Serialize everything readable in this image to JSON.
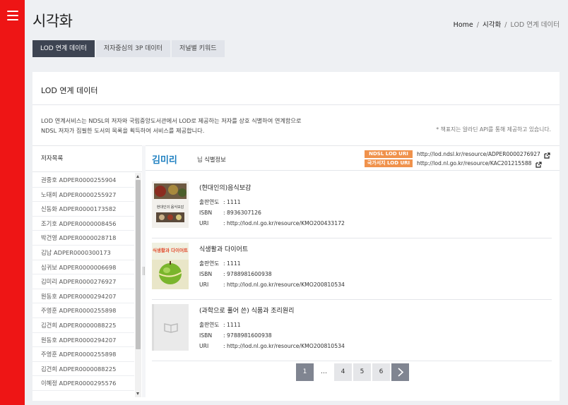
{
  "header": {
    "title": "시각화"
  },
  "breadcrumb": {
    "home": "Home",
    "sep1": "/",
    "section": "시각화",
    "sep2": "/",
    "current": "LOD 연계 데이터"
  },
  "tabs": [
    {
      "label": "LOD 연계 데이터",
      "active": true
    },
    {
      "label": "저자중심의 3P 데이터",
      "active": false
    },
    {
      "label": "저널별 키워드",
      "active": false
    }
  ],
  "panel": {
    "title": "LOD 연계 데이터",
    "desc_line1": "LOD 연계서비스는 NDSL의 저자와 국립중앙도서관에서 LOD로 제공하는 저자를 상호 식별하여 연계함으로",
    "desc_line2": "NDSL 저자가 집필한 도서의 목록을 획득하여 서비스를 제공합니다.",
    "note": "* 책표지는 알라딘 API를 통해 제공하고 있습니다."
  },
  "author_list": {
    "header": "저자목록",
    "items": [
      "권중호 ADPER0000255904",
      "노태희 ADPER0000255927",
      "신동화 ADPER0000173582",
      "조기호 ADPER0000008456",
      "박건영 ADPER0000028718",
      "김남 ADPER0000300173",
      "심귀보 ADPER0000006698",
      "김미리 ADPER0000276927",
      "원동호 ADPER0000294207",
      "주영훈 ADPER0000255898",
      "김건희 ADPER0000088225",
      "원동호 ADPER0000294207",
      "주영훈 ADPER0000255898",
      "김건희 ADPER0000088225",
      "이혜정 ADPER0000295576"
    ]
  },
  "detail": {
    "author_name": "김미리",
    "author_sub": "님 식별정보",
    "ndsl_label": "NDSL LOD URI",
    "ndsl_uri": "http://lod.ndsl.kr/resource/ADPER0000276927",
    "nl_label": "국가서지 LOD URI",
    "nl_uri": "http://lod.nl.go.kr/resource/KAC201215588",
    "year_label": "출판연도",
    "isbn_label": "ISBN",
    "uri_label": "URI",
    "books": [
      {
        "title": "(현대인의)음식보감",
        "year": ": 1111",
        "isbn": ": 8936307126",
        "uri": ": http://lod.nl.go.kr/resource/KMO200433172",
        "cover_text": "현대인의 음식보감"
      },
      {
        "title": "식생활과 다이어트",
        "year": ": 1111",
        "isbn": ": 9788981600938",
        "uri": ": http://lod.nl.go.kr/resource/KMO200810534",
        "cover_text": "식생활과 다이어트"
      },
      {
        "title": "(과학으로 풀어 쓴) 식품과 조리원리",
        "year": ": 1111",
        "isbn": ": 9788981600938",
        "uri": ": http://lod.nl.go.kr/resource/KMO200810534",
        "cover_text": ""
      }
    ]
  },
  "pagination": {
    "pages": [
      "1",
      "…",
      "4",
      "5",
      "6"
    ],
    "active": "1",
    "next": "›"
  },
  "colors": {
    "sidebar": "#ee1515",
    "tab_active": "#3d4452",
    "accent_blue": "#1d7fc0",
    "badge_orange": "#f0924c",
    "pager_active": "#808591"
  }
}
